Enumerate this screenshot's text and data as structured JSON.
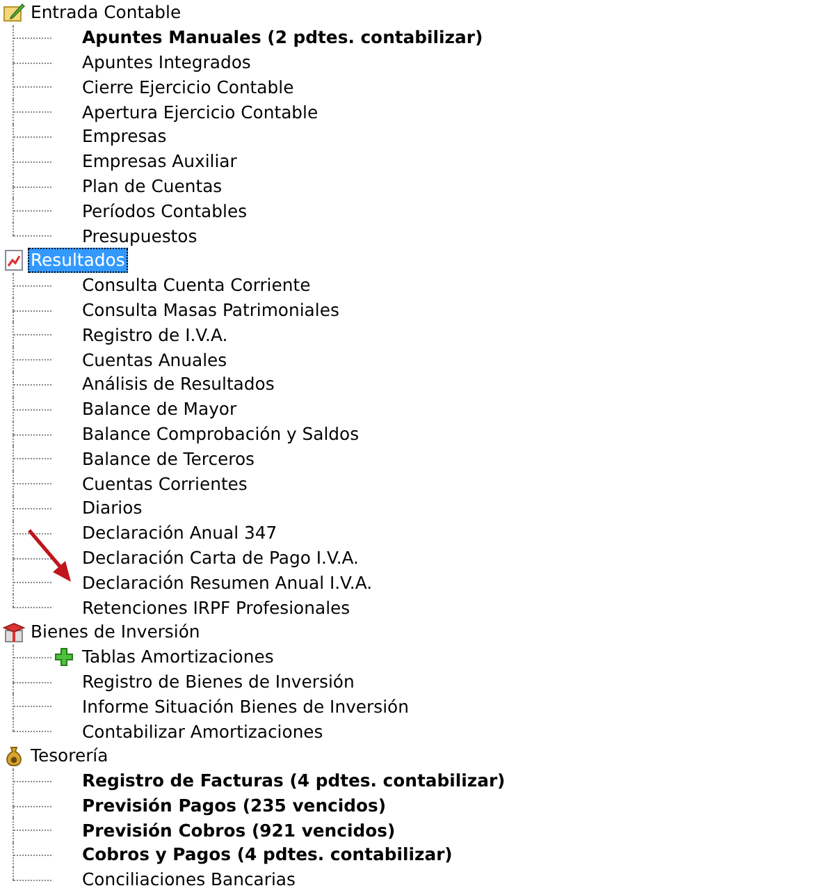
{
  "groups": [
    {
      "label": "Entrada Contable",
      "selected": false,
      "children": [
        {
          "label": "Apuntes Manuales (2 pdtes. contabilizar)",
          "bold": true
        },
        {
          "label": "Apuntes Integrados",
          "bold": false
        },
        {
          "label": "Cierre Ejercicio Contable",
          "bold": false
        },
        {
          "label": "Apertura Ejercicio Contable",
          "bold": false
        },
        {
          "label": "Empresas",
          "bold": false
        },
        {
          "label": "Empresas Auxiliar",
          "bold": false
        },
        {
          "label": "Plan de Cuentas",
          "bold": false
        },
        {
          "label": "Períodos Contables",
          "bold": false
        },
        {
          "label": "Presupuestos",
          "bold": false
        }
      ]
    },
    {
      "label": "Resultados",
      "selected": true,
      "children": [
        {
          "label": "Consulta Cuenta Corriente",
          "bold": false
        },
        {
          "label": "Consulta Masas Patrimoniales",
          "bold": false
        },
        {
          "label": "Registro de I.V.A.",
          "bold": false
        },
        {
          "label": "Cuentas Anuales",
          "bold": false
        },
        {
          "label": "Análisis de Resultados",
          "bold": false
        },
        {
          "label": "Balance de Mayor",
          "bold": false
        },
        {
          "label": "Balance Comprobación y Saldos",
          "bold": false
        },
        {
          "label": "Balance de Terceros",
          "bold": false
        },
        {
          "label": "Cuentas Corrientes",
          "bold": false
        },
        {
          "label": "Diarios",
          "bold": false
        },
        {
          "label": "Declaración Anual 347",
          "bold": false
        },
        {
          "label": "Declaración Carta de Pago I.V.A.",
          "bold": false
        },
        {
          "label": "Declaración Resumen Anual I.V.A.",
          "bold": false
        },
        {
          "label": "Retenciones IRPF Profesionales",
          "bold": false
        }
      ]
    },
    {
      "label": "Bienes de Inversión",
      "selected": false,
      "children": [
        {
          "label": "Tablas Amortizaciones",
          "bold": false,
          "expandable": true
        },
        {
          "label": "Registro de Bienes de Inversión",
          "bold": false,
          "expandable": false
        },
        {
          "label": "Informe Situación Bienes de Inversión",
          "bold": false,
          "expandable": false
        },
        {
          "label": "Contabilizar Amortizaciones",
          "bold": false,
          "expandable": false
        }
      ]
    },
    {
      "label": "Tesorería",
      "selected": false,
      "children": [
        {
          "label": "Registro de Facturas (4 pdtes. contabilizar)",
          "bold": true
        },
        {
          "label": "Previsión Pagos (235 vencidos)",
          "bold": true
        },
        {
          "label": "Previsión Cobros (921 vencidos)",
          "bold": true
        },
        {
          "label": "Cobros y Pagos (4 pdtes. contabilizar)",
          "bold": true
        },
        {
          "label": "Conciliaciones Bancarias",
          "bold": false
        }
      ]
    }
  ]
}
